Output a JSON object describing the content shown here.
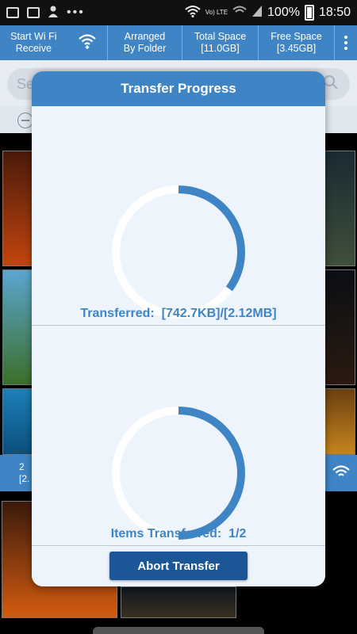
{
  "status_bar": {
    "battery": "100%",
    "time": "18:50",
    "network_label": "Vo) LTE",
    "dots": "•••"
  },
  "toolbar": {
    "wifi_receive_label_line1": "Start Wi Fi",
    "wifi_receive_label_line2": "Receive",
    "arranged_line1": "Arranged",
    "arranged_line2": "By Folder",
    "total_space_label": "Total Space",
    "total_space_value": "[11.0GB]",
    "free_space_label": "Free Space",
    "free_space_value": "[3.45GB]",
    "icons": [
      "wifi-icon",
      "more-vertical-icon"
    ]
  },
  "background": {
    "search_placeholder": "Se",
    "bar_text_line1": "2",
    "bar_text_line2": "[2."
  },
  "modal": {
    "title": "Transfer Progress",
    "transferred_label": "Transferred:",
    "transferred_value": "[742.7KB]/[2.12MB]",
    "items_label": "Items Transferred:",
    "items_value": "1/2",
    "abort_label": "Abort Transfer",
    "bytes_progress_fraction": 0.35,
    "items_progress_fraction": 0.5
  },
  "colors": {
    "accent": "#3f85c6",
    "button": "#1b5796",
    "modal_bg": "#eef4fb"
  }
}
